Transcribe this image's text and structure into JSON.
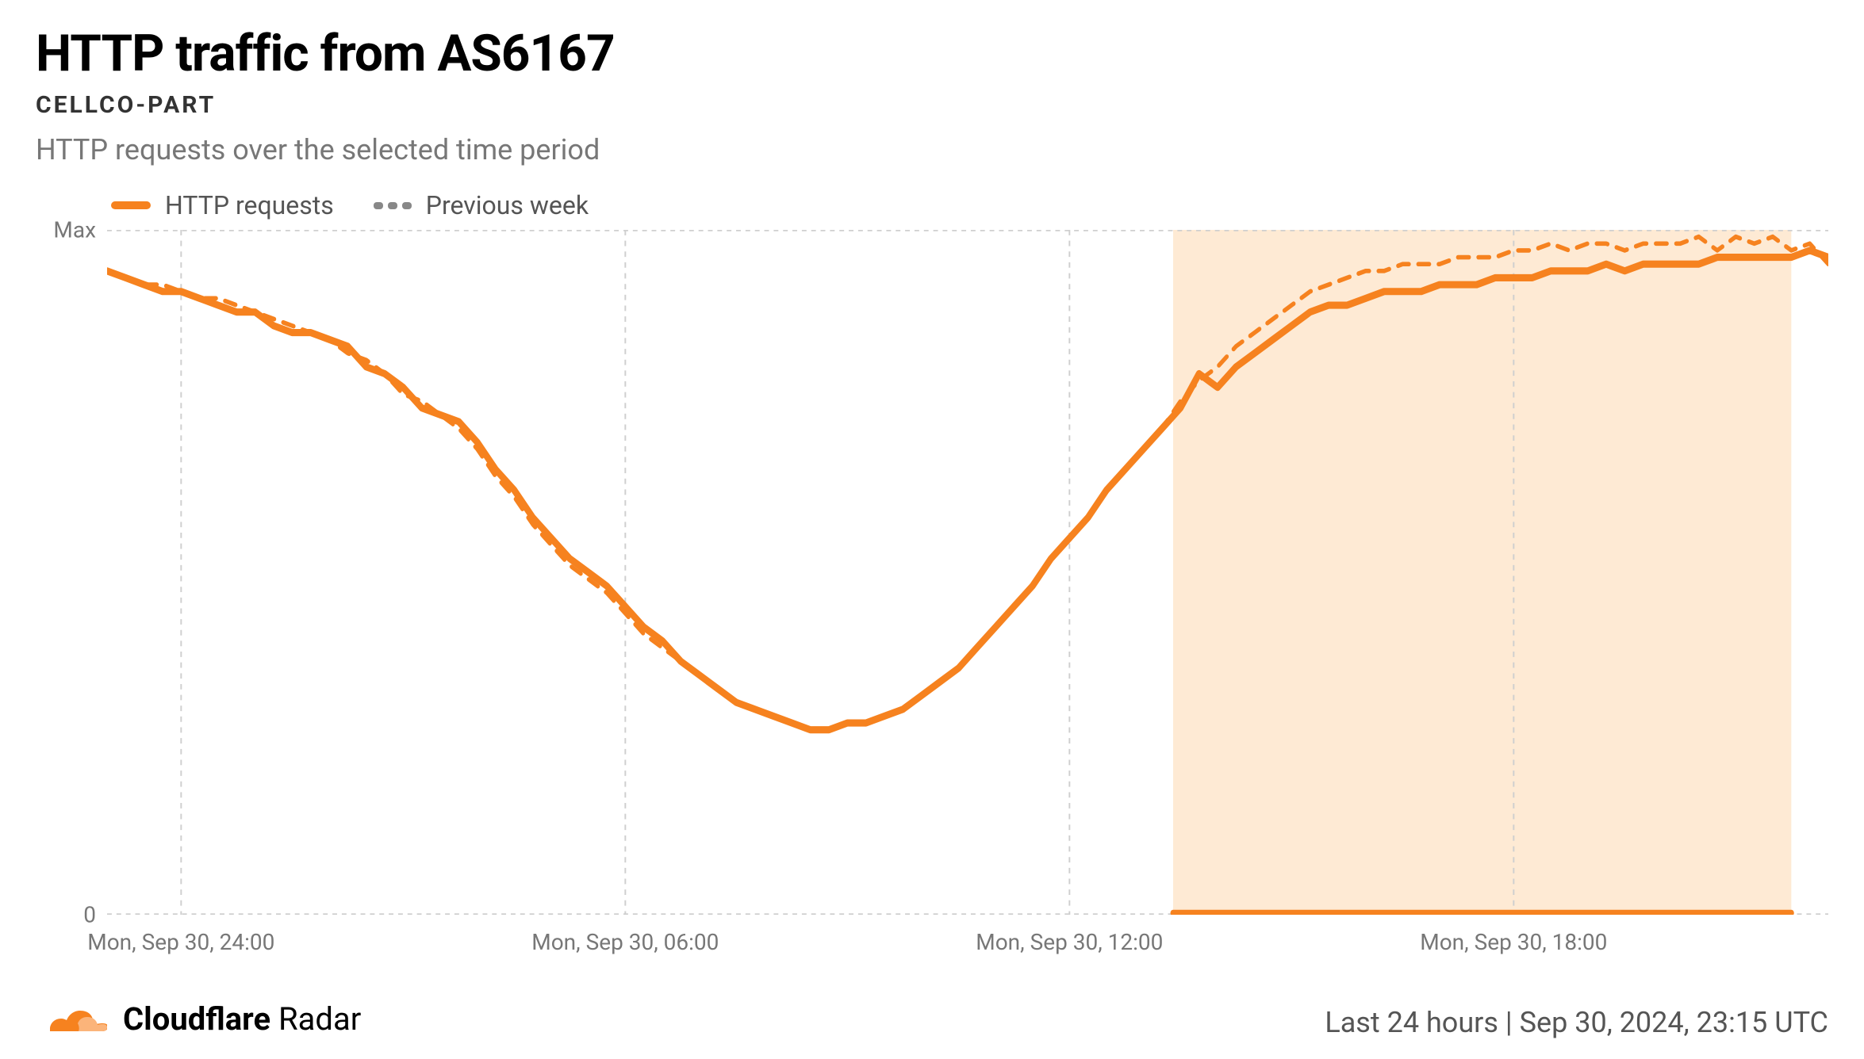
{
  "header": {
    "title": "HTTP traffic from AS6167",
    "subtitle": "CELLCO-PART",
    "description": "HTTP requests over the selected time period"
  },
  "legend": {
    "series1": "HTTP requests",
    "series2": "Previous week"
  },
  "yaxis": {
    "max_label": "Max",
    "zero_label": "0"
  },
  "xaxis": {
    "ticks": [
      "Mon, Sep 30, 24:00",
      "Mon, Sep 30, 06:00",
      "Mon, Sep 30, 12:00",
      "Mon, Sep 30, 18:00"
    ]
  },
  "footer": {
    "brand_bold": "Cloudflare",
    "brand_light": " Radar",
    "timestamp": "Last 24 hours | Sep 30, 2024, 23:15 UTC"
  },
  "colors": {
    "accent": "#f6821f",
    "grid": "#cfcfcf",
    "highlight_fill": "#fde3c6",
    "text_muted": "#777"
  },
  "chart_data": {
    "type": "line",
    "title": "HTTP traffic from AS6167",
    "xlabel": "",
    "ylabel": "",
    "ylim": [
      0,
      100
    ],
    "y_label_top": "Max",
    "y_label_bottom": "0",
    "x_tick_labels": [
      "Mon, Sep 30, 24:00",
      "Mon, Sep 30, 06:00",
      "Mon, Sep 30, 12:00",
      "Mon, Sep 30, 18:00"
    ],
    "x_tick_positions_hours": [
      1,
      7,
      13,
      19
    ],
    "highlight_region_hours": [
      14.4,
      22.75
    ],
    "x": [
      0.0,
      0.25,
      0.5,
      0.75,
      1.0,
      1.25,
      1.5,
      1.75,
      2.0,
      2.25,
      2.5,
      2.75,
      3.0,
      3.25,
      3.5,
      3.75,
      4.0,
      4.25,
      4.5,
      4.75,
      5.0,
      5.25,
      5.5,
      5.75,
      6.0,
      6.25,
      6.5,
      6.75,
      7.0,
      7.25,
      7.5,
      7.75,
      8.0,
      8.25,
      8.5,
      8.75,
      9.0,
      9.25,
      9.5,
      9.75,
      10.0,
      10.25,
      10.5,
      10.75,
      11.0,
      11.25,
      11.5,
      11.75,
      12.0,
      12.25,
      12.5,
      12.75,
      13.0,
      13.25,
      13.5,
      13.75,
      14.0,
      14.25,
      14.5,
      14.75,
      15.0,
      15.25,
      15.5,
      15.75,
      16.0,
      16.25,
      16.5,
      16.75,
      17.0,
      17.25,
      17.5,
      17.75,
      18.0,
      18.25,
      18.5,
      18.75,
      19.0,
      19.25,
      19.5,
      19.75,
      20.0,
      20.25,
      20.5,
      20.75,
      21.0,
      21.25,
      21.5,
      21.75,
      22.0,
      22.25,
      22.5,
      22.75,
      23.0,
      23.25
    ],
    "series": [
      {
        "name": "HTTP requests",
        "style": "solid",
        "color": "#f6821f",
        "values": [
          94,
          93,
          92,
          91,
          91,
          90,
          89,
          88,
          88,
          86,
          85,
          85,
          84,
          83,
          80,
          79,
          77,
          74,
          73,
          72,
          69,
          65,
          62,
          58,
          55,
          52,
          50,
          48,
          45,
          42,
          40,
          37,
          35,
          33,
          31,
          30,
          29,
          28,
          27,
          27,
          28,
          28,
          29,
          30,
          32,
          34,
          36,
          39,
          42,
          45,
          48,
          52,
          55,
          58,
          62,
          65,
          68,
          71,
          74,
          79,
          77,
          80,
          82,
          84,
          86,
          88,
          89,
          89,
          90,
          91,
          91,
          91,
          92,
          92,
          92,
          93,
          93,
          93,
          94,
          94,
          94,
          95,
          94,
          95,
          95,
          95,
          95,
          96,
          96,
          96,
          96,
          96,
          97,
          96
        ]
      },
      {
        "name": "Previous week",
        "style": "dashed",
        "color": "#f6821f",
        "values": [
          94,
          93,
          92,
          92,
          91,
          90,
          90,
          89,
          88,
          87,
          86,
          85,
          84,
          82,
          81,
          79,
          76,
          75,
          73,
          71,
          68,
          64,
          61,
          57,
          54,
          51,
          49,
          47,
          44,
          41,
          39,
          37,
          35,
          33,
          31,
          30,
          29,
          28,
          27,
          27,
          28,
          28,
          29,
          30,
          32,
          34,
          36,
          39,
          42,
          45,
          48,
          52,
          55,
          58,
          62,
          65,
          68,
          71,
          75,
          78,
          80,
          83,
          85,
          87,
          89,
          91,
          92,
          93,
          94,
          94,
          95,
          95,
          95,
          96,
          96,
          96,
          97,
          97,
          98,
          97,
          98,
          98,
          97,
          98,
          98,
          98,
          99,
          97,
          99,
          98,
          99,
          97,
          98,
          95
        ]
      }
    ]
  }
}
